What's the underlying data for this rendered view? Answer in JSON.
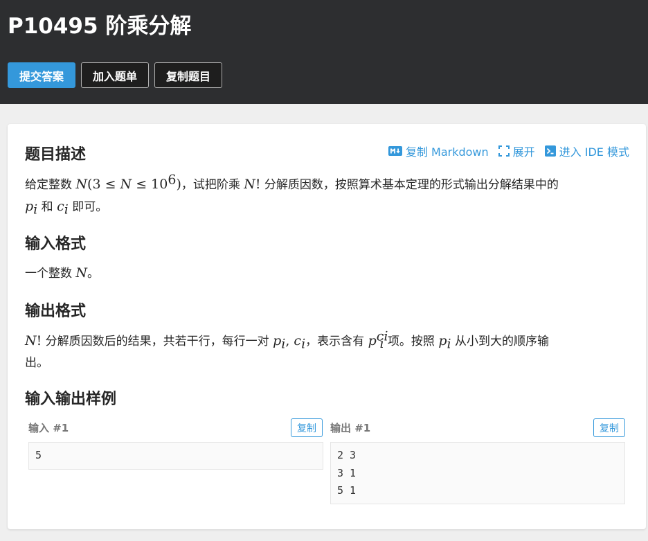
{
  "header": {
    "title": "P10495 阶乘分解",
    "buttons": {
      "submit": "提交答案",
      "add_list": "加入题单",
      "copy_problem": "复制题目"
    }
  },
  "toolbar": {
    "copy_markdown": "复制 Markdown",
    "expand": "展开",
    "ide_mode": "进入 IDE 模式"
  },
  "sections": {
    "description_title": "题目描述",
    "description": {
      "t1": "给定整数 ",
      "n": "N",
      "open": "(3 ≤ ",
      "n2": "N",
      "le": " ≤ 10",
      "exp": "6",
      "close": ")",
      "t2": "，试把阶乘 ",
      "nfact": "N",
      "bang": "!",
      "t3": " 分解质因数，按照算术基本定理的形式输出分解结果中的",
      "p": "p",
      "psub": "i",
      "t4": " 和 ",
      "c": "c",
      "csub": "i",
      "t5": " 即可。"
    },
    "input_title": "输入格式",
    "input": {
      "t1": "一个整数 ",
      "n": "N",
      "t2": "。"
    },
    "output_title": "输出格式",
    "output": {
      "n": "N",
      "bang": "!",
      "t1": " 分解质因数后的结果，共若干行，每行一对 ",
      "p": "p",
      "psub": "i",
      "comma": ", ",
      "c": "c",
      "csub": "i",
      "t2": "，表示含有 ",
      "p2": "p",
      "p2sub": "i",
      "p2sup": "ci",
      "t3": " 项。按照 ",
      "p3": "p",
      "p3sub": "i",
      "t4": " 从小到大的顺序输",
      "t5": "出。"
    },
    "samples_title": "输入输出样例"
  },
  "samples": {
    "input_label": "输入 #1",
    "output_label": "输出 #1",
    "copy_label": "复制",
    "input_lines": [
      "5"
    ],
    "output_lines": [
      "2 3",
      "3 1",
      "5 1"
    ]
  },
  "colors": {
    "accent": "#3498db",
    "header_bg": "#2d2e30"
  }
}
